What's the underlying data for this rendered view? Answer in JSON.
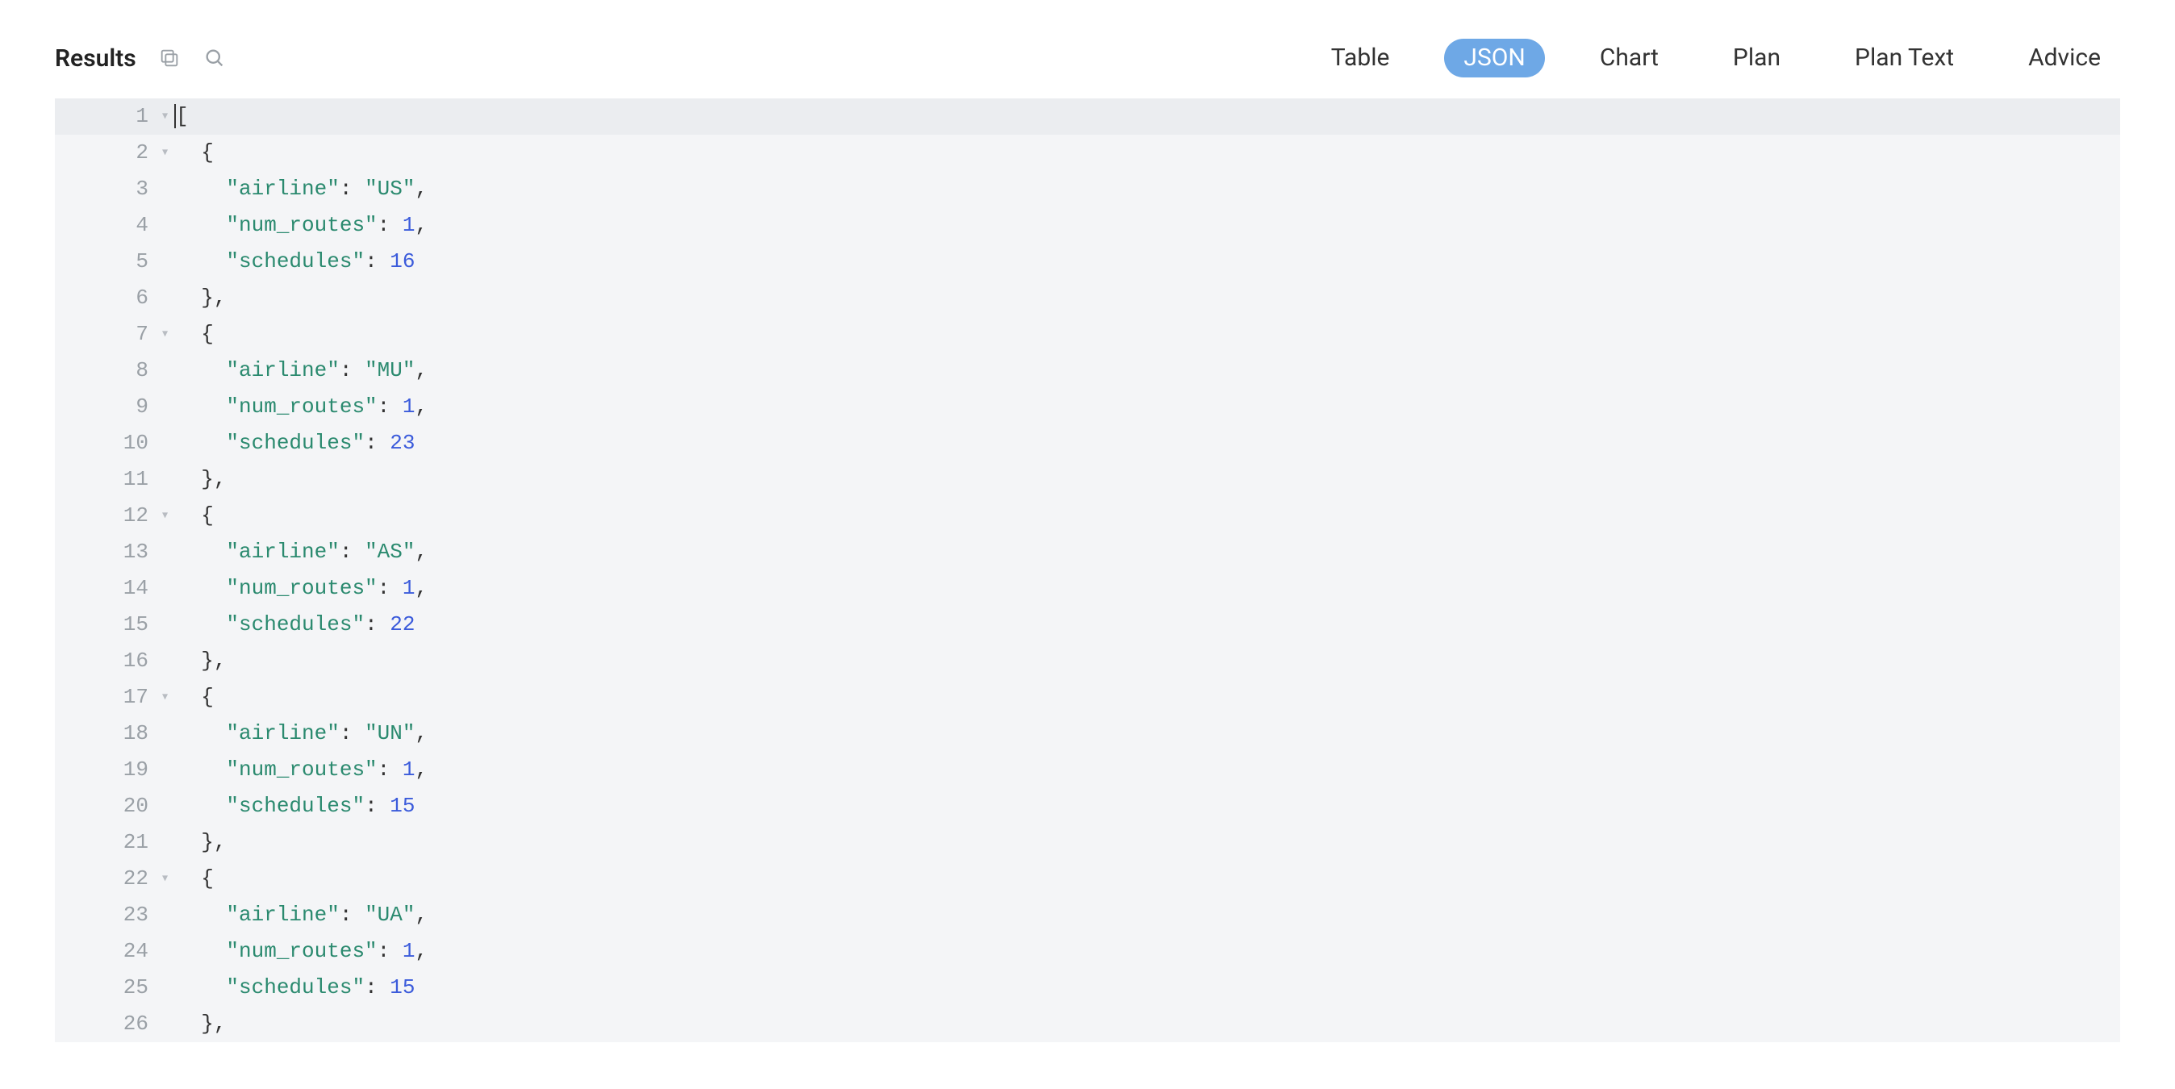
{
  "header": {
    "title": "Results",
    "icons": {
      "copy": "copy-icon",
      "search": "search-icon"
    }
  },
  "tabs": {
    "items": [
      {
        "label": "Table",
        "active": false
      },
      {
        "label": "JSON",
        "active": true
      },
      {
        "label": "Chart",
        "active": false
      },
      {
        "label": "Plan",
        "active": false
      },
      {
        "label": "Plan Text",
        "active": false
      },
      {
        "label": "Advice",
        "active": false
      }
    ]
  },
  "json_field_names": {
    "airline": "airline",
    "num_routes": "num_routes",
    "schedules": "schedules"
  },
  "json_results": [
    {
      "airline": "US",
      "num_routes": 1,
      "schedules": 16
    },
    {
      "airline": "MU",
      "num_routes": 1,
      "schedules": 23
    },
    {
      "airline": "AS",
      "num_routes": 1,
      "schedules": 22
    },
    {
      "airline": "UN",
      "num_routes": 1,
      "schedules": 15
    },
    {
      "airline": "UA",
      "num_routes": 1,
      "schedules": 15
    }
  ],
  "editor": {
    "visible_line_count": 26,
    "lines": [
      {
        "n": 1,
        "fold": true,
        "indent": 0,
        "type": "open_array"
      },
      {
        "n": 2,
        "fold": true,
        "indent": 1,
        "type": "open_obj"
      },
      {
        "n": 3,
        "fold": false,
        "indent": 2,
        "type": "kv_str",
        "obj": 0,
        "key": "airline",
        "comma": true
      },
      {
        "n": 4,
        "fold": false,
        "indent": 2,
        "type": "kv_num",
        "obj": 0,
        "key": "num_routes",
        "comma": true
      },
      {
        "n": 5,
        "fold": false,
        "indent": 2,
        "type": "kv_num",
        "obj": 0,
        "key": "schedules",
        "comma": false
      },
      {
        "n": 6,
        "fold": false,
        "indent": 1,
        "type": "close_obj",
        "comma": true
      },
      {
        "n": 7,
        "fold": true,
        "indent": 1,
        "type": "open_obj"
      },
      {
        "n": 8,
        "fold": false,
        "indent": 2,
        "type": "kv_str",
        "obj": 1,
        "key": "airline",
        "comma": true
      },
      {
        "n": 9,
        "fold": false,
        "indent": 2,
        "type": "kv_num",
        "obj": 1,
        "key": "num_routes",
        "comma": true
      },
      {
        "n": 10,
        "fold": false,
        "indent": 2,
        "type": "kv_num",
        "obj": 1,
        "key": "schedules",
        "comma": false
      },
      {
        "n": 11,
        "fold": false,
        "indent": 1,
        "type": "close_obj",
        "comma": true
      },
      {
        "n": 12,
        "fold": true,
        "indent": 1,
        "type": "open_obj"
      },
      {
        "n": 13,
        "fold": false,
        "indent": 2,
        "type": "kv_str",
        "obj": 2,
        "key": "airline",
        "comma": true
      },
      {
        "n": 14,
        "fold": false,
        "indent": 2,
        "type": "kv_num",
        "obj": 2,
        "key": "num_routes",
        "comma": true
      },
      {
        "n": 15,
        "fold": false,
        "indent": 2,
        "type": "kv_num",
        "obj": 2,
        "key": "schedules",
        "comma": false
      },
      {
        "n": 16,
        "fold": false,
        "indent": 1,
        "type": "close_obj",
        "comma": true
      },
      {
        "n": 17,
        "fold": true,
        "indent": 1,
        "type": "open_obj"
      },
      {
        "n": 18,
        "fold": false,
        "indent": 2,
        "type": "kv_str",
        "obj": 3,
        "key": "airline",
        "comma": true
      },
      {
        "n": 19,
        "fold": false,
        "indent": 2,
        "type": "kv_num",
        "obj": 3,
        "key": "num_routes",
        "comma": true
      },
      {
        "n": 20,
        "fold": false,
        "indent": 2,
        "type": "kv_num",
        "obj": 3,
        "key": "schedules",
        "comma": false
      },
      {
        "n": 21,
        "fold": false,
        "indent": 1,
        "type": "close_obj",
        "comma": true
      },
      {
        "n": 22,
        "fold": true,
        "indent": 1,
        "type": "open_obj"
      },
      {
        "n": 23,
        "fold": false,
        "indent": 2,
        "type": "kv_str",
        "obj": 4,
        "key": "airline",
        "comma": true
      },
      {
        "n": 24,
        "fold": false,
        "indent": 2,
        "type": "kv_num",
        "obj": 4,
        "key": "num_routes",
        "comma": true
      },
      {
        "n": 25,
        "fold": false,
        "indent": 2,
        "type": "kv_num",
        "obj": 4,
        "key": "schedules",
        "comma": false
      },
      {
        "n": 26,
        "fold": false,
        "indent": 1,
        "type": "close_obj",
        "comma": true
      }
    ]
  }
}
